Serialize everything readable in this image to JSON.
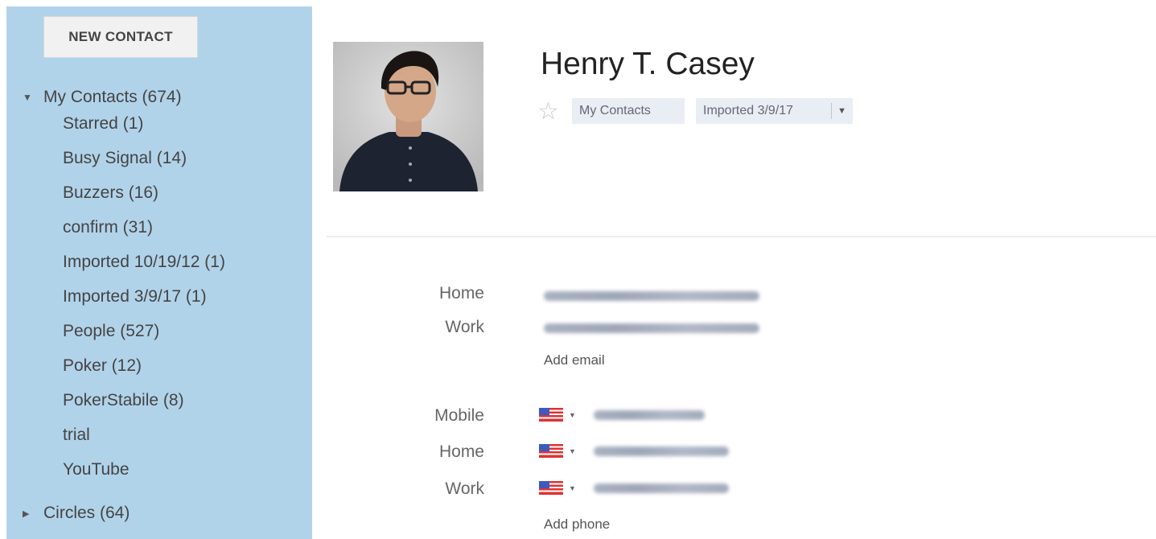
{
  "sidebar": {
    "new_contact_label": "NEW CONTACT",
    "my_contacts_label": "My Contacts (674)",
    "groups": [
      "Starred (1)",
      "Busy Signal (14)",
      "Buzzers (16)",
      "confirm (31)",
      "Imported 10/19/12 (1)",
      "Imported 3/9/17 (1)",
      "People (527)",
      "Poker (12)",
      "PokerStabile (8)",
      "trial",
      "YouTube"
    ],
    "circles_label": "Circles (64)"
  },
  "contact": {
    "name": "Henry T. Casey",
    "tags": [
      "My Contacts",
      "Imported 3/9/17"
    ],
    "email_labels": [
      "Home",
      "Work"
    ],
    "add_email_label": "Add email",
    "phone_labels": [
      "Mobile",
      "Home",
      "Work"
    ],
    "add_phone_label": "Add phone"
  },
  "icons": {
    "star": "star-outline-icon",
    "tag_dropdown": "chevron-down-icon",
    "tree_expanded": "triangle-down-icon",
    "tree_collapsed": "triangle-right-icon",
    "phone_country": "us-flag-icon"
  },
  "colors": {
    "sidebar_bg": "#b1d3ea",
    "tag_bg": "#e8eef3"
  }
}
